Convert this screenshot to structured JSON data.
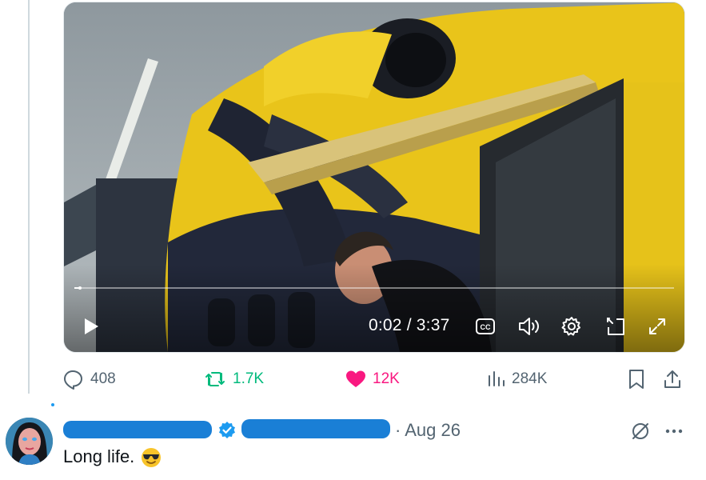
{
  "video": {
    "current_time": "0:02",
    "separator": " / ",
    "duration": "3:37",
    "progress": 0.009,
    "controls": [
      "play-icon",
      "closed-captions-icon",
      "volume-icon",
      "settings-icon",
      "picture-in-picture-icon",
      "fullscreen-icon"
    ]
  },
  "actions": {
    "replies": "408",
    "reposts": "1.7K",
    "likes": "12K",
    "views": "284K"
  },
  "colors": {
    "repost": "#00ba7c",
    "like": "#f91880",
    "muted_text": "#536471",
    "verified": "#1d9bf0",
    "redaction": "#1a7fd6"
  },
  "reply": {
    "meta": "· Aug 26",
    "text": "Long life.",
    "emoji": "smiling-face-with-sunglasses-emoji"
  }
}
